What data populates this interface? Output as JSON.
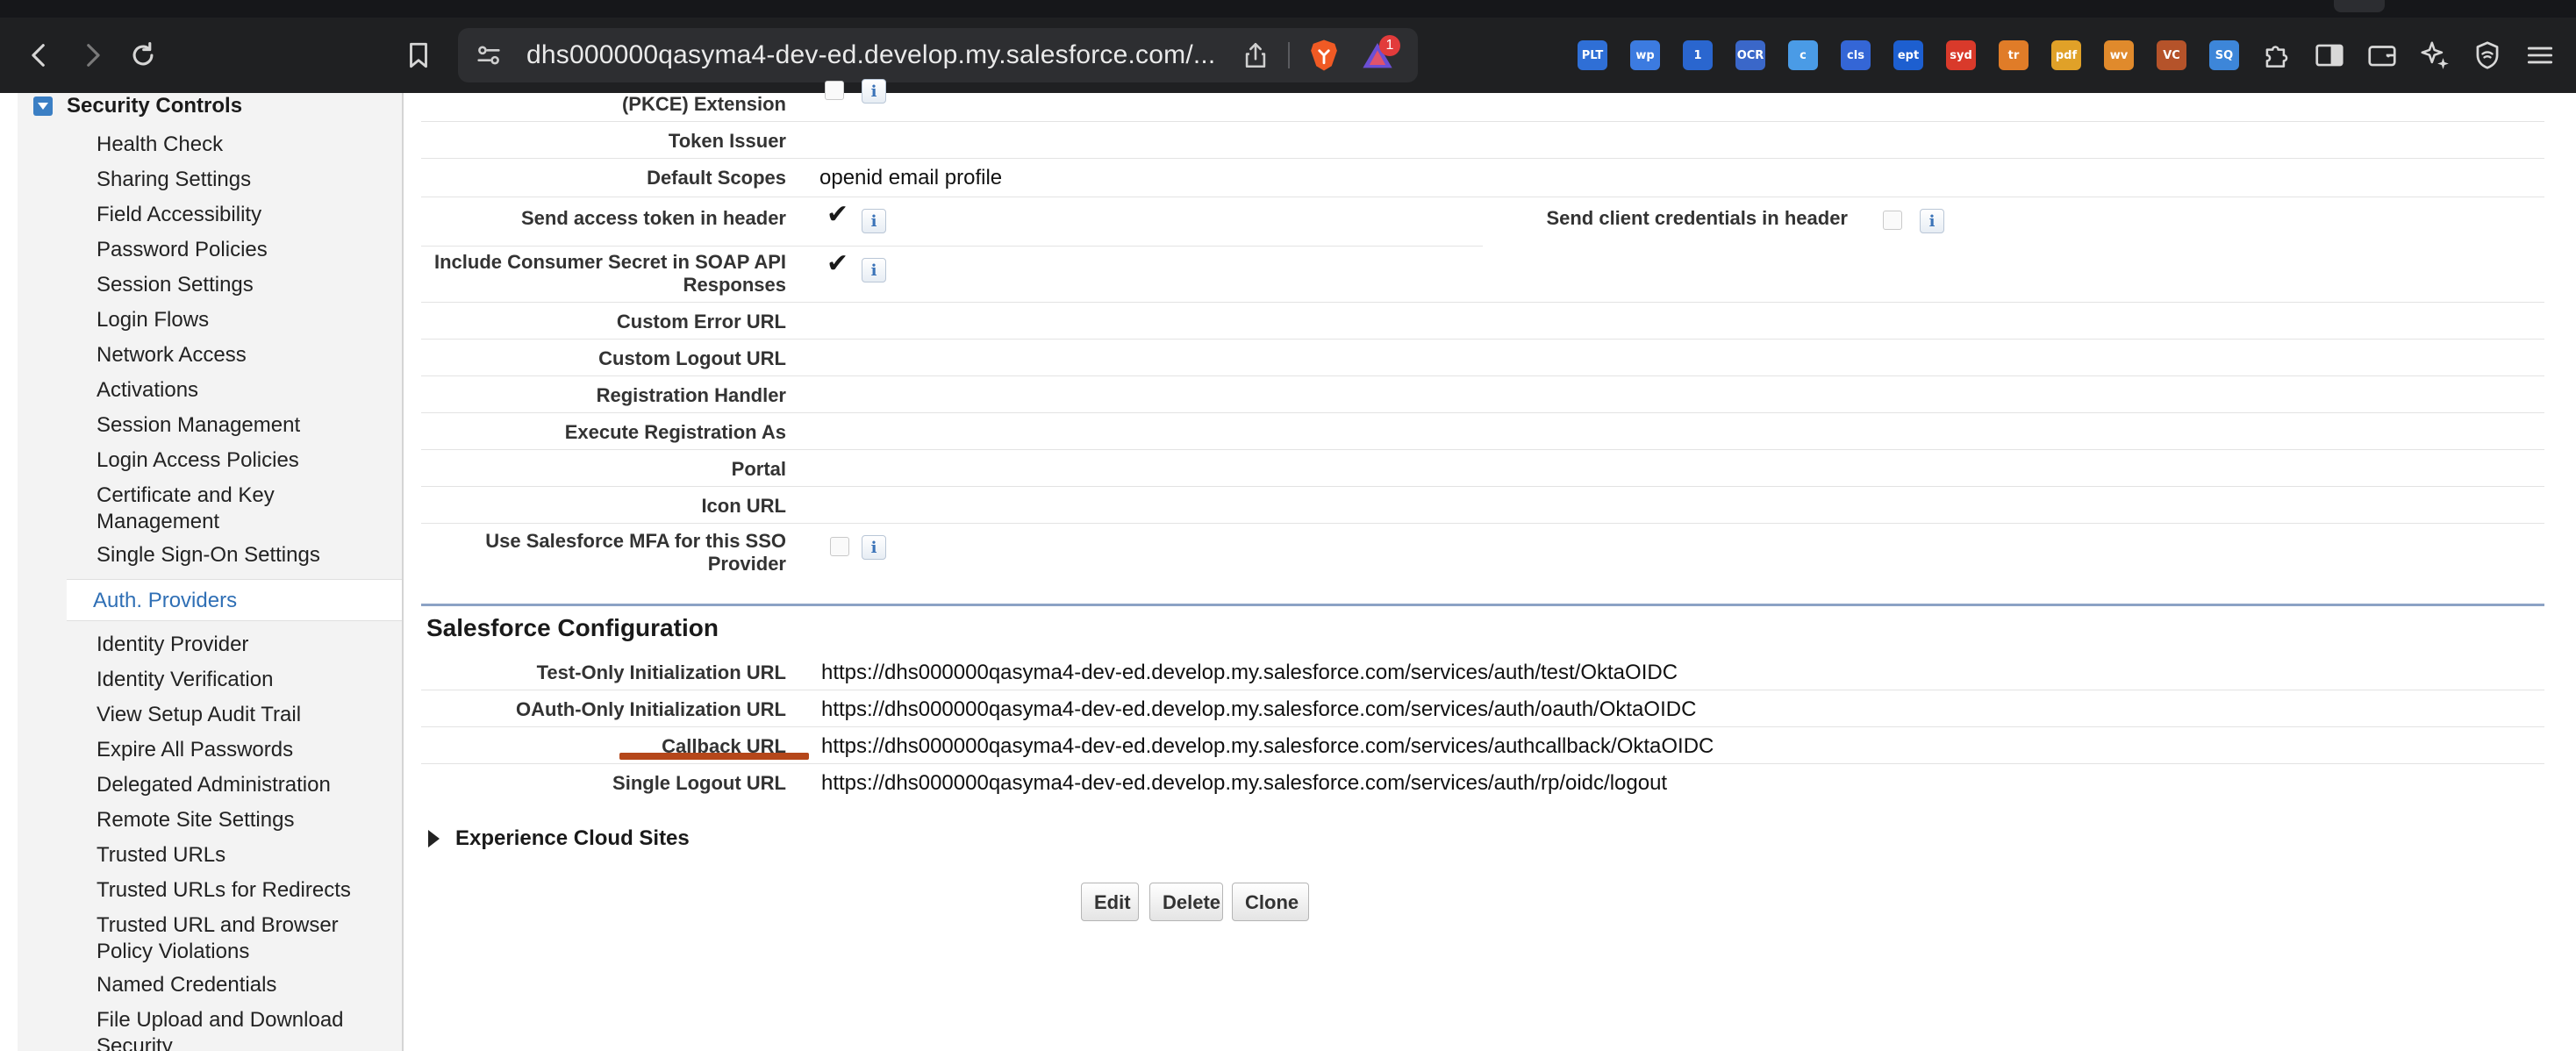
{
  "browser": {
    "url": "dhs000000qasyma4-dev-ed.develop.my.salesforce.com/...",
    "notification_count": "1",
    "extensions": [
      {
        "label": "PLT",
        "color": "#2f6fd6"
      },
      {
        "label": "wp",
        "color": "#3c7be0"
      },
      {
        "label": "1",
        "color": "#2a66cf"
      },
      {
        "label": "OCR",
        "color": "#3a67c9"
      },
      {
        "label": "c",
        "color": "#4a9be6"
      },
      {
        "label": "cls",
        "color": "#3466d6"
      },
      {
        "label": "ept",
        "color": "#1d5fd0"
      },
      {
        "label": "syd",
        "color": "#d93a2b"
      },
      {
        "label": "tr",
        "color": "#e07c28"
      },
      {
        "label": "pdf",
        "color": "#e0a128"
      },
      {
        "label": "wv",
        "color": "#e08a2c"
      },
      {
        "label": "VC",
        "color": "#b5532a"
      },
      {
        "label": "SQ",
        "color": "#3d86d9"
      }
    ]
  },
  "sidebar": {
    "section_title": "Security Controls",
    "items": [
      "Health Check",
      "Sharing Settings",
      "Field Accessibility",
      "Password Policies",
      "Session Settings",
      "Login Flows",
      "Network Access",
      "Activations",
      "Session Management",
      "Login Access Policies",
      "Certificate and Key Management",
      "Single Sign-On Settings",
      "Auth. Providers",
      "Identity Provider",
      "Identity Verification",
      "View Setup Audit Trail",
      "Expire All Passwords",
      "Delegated Administration",
      "Remote Site Settings",
      "Trusted URLs",
      "Trusted URLs for Redirects",
      "Trusted URL and Browser Policy Violations",
      "Named Credentials",
      "File Upload and Download Security"
    ],
    "active_item": "Auth. Providers"
  },
  "details": {
    "pkce_label": "(PKCE) Extension",
    "token_issuer_label": "Token Issuer",
    "default_scopes_label": "Default Scopes",
    "default_scopes_value": "openid email profile",
    "send_token_header_label": "Send access token in header",
    "send_client_creds_label": "Send client credentials in header",
    "include_secret_label": "Include Consumer Secret in SOAP API Responses",
    "custom_error_url_label": "Custom Error URL",
    "custom_logout_url_label": "Custom Logout URL",
    "registration_handler_label": "Registration Handler",
    "execute_registration_label": "Execute Registration As",
    "portal_label": "Portal",
    "icon_url_label": "Icon URL",
    "use_mfa_label": "Use Salesforce MFA for this SSO Provider",
    "info_glyph": "i",
    "check_glyph": "✔"
  },
  "salesforce_config": {
    "title": "Salesforce Configuration",
    "test_only_label": "Test-Only Initialization URL",
    "test_only_value": "https://dhs000000qasyma4-dev-ed.develop.my.salesforce.com/services/auth/test/OktaOIDC",
    "oauth_only_label": "OAuth-Only Initialization URL",
    "oauth_only_value": "https://dhs000000qasyma4-dev-ed.develop.my.salesforce.com/services/auth/oauth/OktaOIDC",
    "callback_label": "Callback URL",
    "callback_value": "https://dhs000000qasyma4-dev-ed.develop.my.salesforce.com/services/authcallback/OktaOIDC",
    "single_logout_label": "Single Logout URL",
    "single_logout_value": "https://dhs000000qasyma4-dev-ed.develop.my.salesforce.com/services/auth/rp/oidc/logout"
  },
  "experience_cloud": "Experience Cloud Sites",
  "buttons": {
    "edit": "Edit",
    "delete": "Delete",
    "clone": "Clone"
  }
}
